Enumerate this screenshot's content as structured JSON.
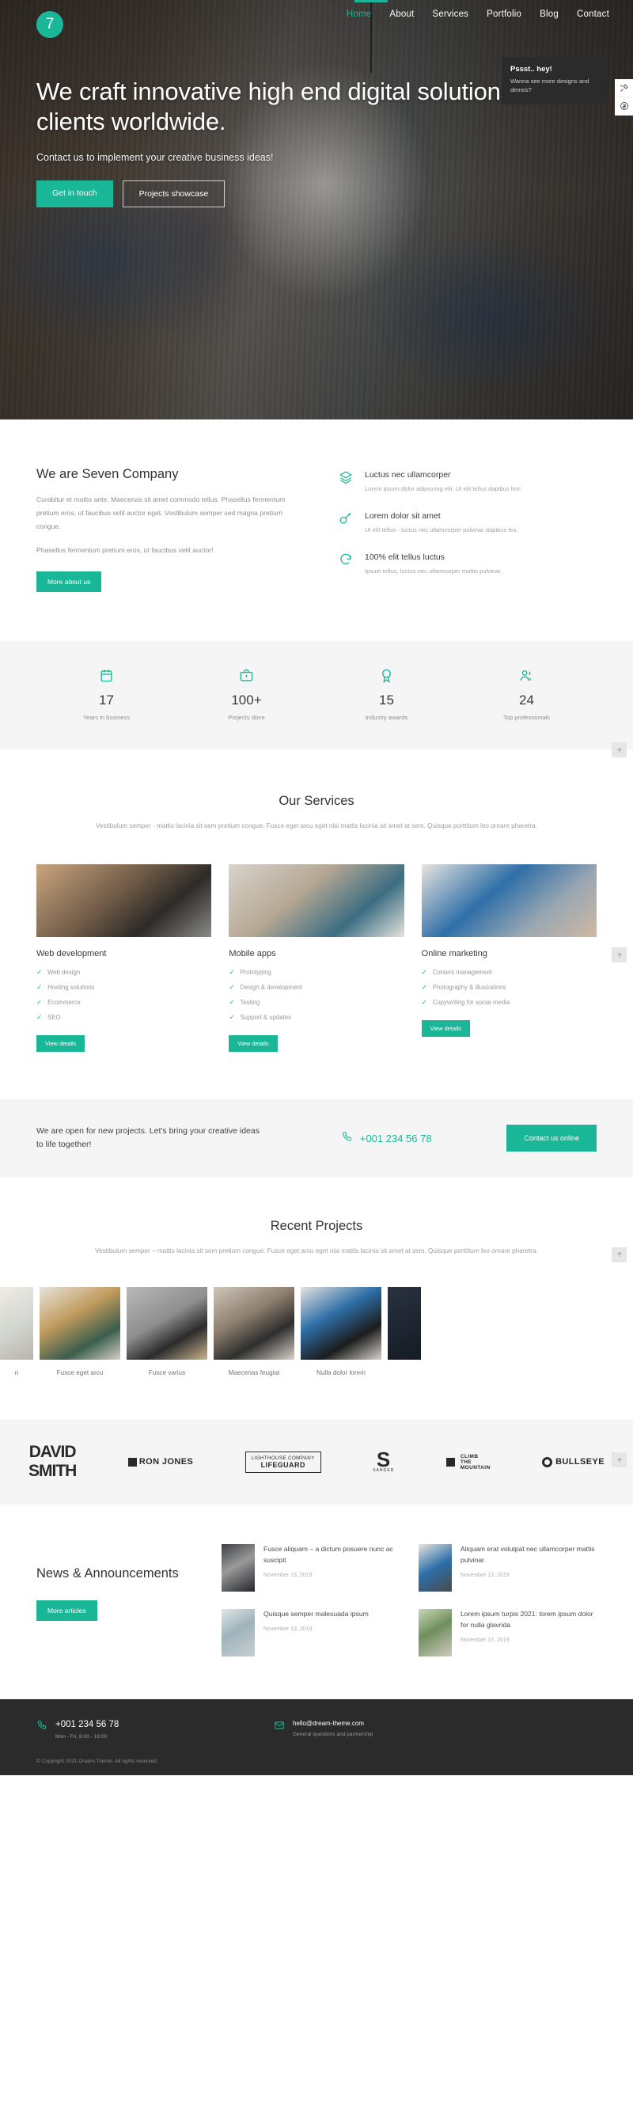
{
  "brand": {
    "logo_text": "7",
    "accent": "#19b698",
    "dark": "#2b2b2b"
  },
  "nav": {
    "items": [
      {
        "label": "Home",
        "active": true
      },
      {
        "label": "About",
        "active": false
      },
      {
        "label": "Services",
        "active": false
      },
      {
        "label": "Portfolio",
        "active": false
      },
      {
        "label": "Blog",
        "active": false
      },
      {
        "label": "Contact",
        "active": false
      }
    ]
  },
  "promo": {
    "title": "Pssst.. hey!",
    "text": "Wanna see more designs and demos?"
  },
  "hero": {
    "heading": "We craft innovative high end digital solutions for clients worldwide.",
    "subheading": "Contact us to implement your creative business ideas!",
    "primary_button": "Get in touch",
    "secondary_button": "Projects showcase"
  },
  "about": {
    "title": "We are Seven Company",
    "paragraph1": "Curabitur et mattis ante. Maecenas sit amet commodo tellus. Phasellus fermentum pretium eros, ut faucibus velit auctor eget. Vestibulum semper sed magna pretium congue.",
    "paragraph2": "Phasellus fermentum pretium eros, ut faucibus velit auctor!",
    "button": "More about us",
    "features": [
      {
        "icon": "layers-icon",
        "title": "Luctus nec ullamcorper",
        "text": "Lorem ipsum dolor adipiscing elit. Ut elit tellus dapibus leo!"
      },
      {
        "icon": "key-icon",
        "title": "Lorem dolor sit amet",
        "text": "Ut elit tellus - luctus nec ullamcorper pulvinar dapibus leo."
      },
      {
        "icon": "refresh-icon",
        "title": "100% elit tellus luctus",
        "text": "Ipsum tellus, luctus nec ullamcorper mattis pulvinar."
      }
    ]
  },
  "stats": [
    {
      "icon": "calendar-icon",
      "number": "17",
      "label": "Years in business"
    },
    {
      "icon": "briefcase-icon",
      "number": "100+",
      "label": "Projects done"
    },
    {
      "icon": "award-icon",
      "number": "15",
      "label": "Industry awards"
    },
    {
      "icon": "people-icon",
      "number": "24",
      "label": "Top professionals"
    }
  ],
  "services": {
    "title": "Our Services",
    "subtitle": "Vestibulum semper - mattis lacinia sit sem pretium congue. Fusce eget arcu eget nisi mattis lacinia sit amet at sem. Quisque porttitum leo ornare pharetra.",
    "cards": [
      {
        "title": "Web development",
        "items": [
          "Web design",
          "Hosting solutions",
          "Ecommerce",
          "SEO"
        ],
        "button": "View details"
      },
      {
        "title": "Mobile apps",
        "items": [
          "Prototyping",
          "Design & development",
          "Testing",
          "Support & updates"
        ],
        "button": "View details"
      },
      {
        "title": "Online marketing",
        "items": [
          "Content management",
          "Photography & illustrations",
          "Copywriting for social media"
        ],
        "button": "View details"
      }
    ]
  },
  "cta": {
    "text": "We are open for new projects. Let's bring your creative ideas to life together!",
    "phone": "+001 234 56 78",
    "button": "Contact us online"
  },
  "projects": {
    "title": "Recent Projects",
    "subtitle": "Vestibulum semper – mattis lacinia sit sem pretium congue. Fusce eget arcu eget nisi mattis lacinia sit amet at sem. Quisque porttitum leo ornare pharetra.",
    "items": [
      {
        "caption": "n"
      },
      {
        "caption": "Fusce eget arcu"
      },
      {
        "caption": "Fusce varius"
      },
      {
        "caption": "Maecenas feugiat"
      },
      {
        "caption": "Nulla dolor lorem"
      },
      {
        "caption": ""
      }
    ]
  },
  "clients": [
    {
      "kind": "david",
      "line1": "DAVID",
      "line2": "SMITH"
    },
    {
      "kind": "ronjones",
      "line1": "RJ",
      "line2": "RON JONES"
    },
    {
      "kind": "lifeguard",
      "line1": "LIGHTHOUSE COMPANY",
      "line2": "LIFEGUARD"
    },
    {
      "kind": "sanger",
      "line1": "S",
      "line2": "SANGER"
    },
    {
      "kind": "climb",
      "line1": "CLIMB",
      "line2": "THE",
      "line3": "MOUNTAIN"
    },
    {
      "kind": "bullseye",
      "line1": "BULLSEYE"
    }
  ],
  "news": {
    "title": "News & Announcements",
    "button": "More articles",
    "posts": [
      {
        "title": "Fusce aliquam – a dictum posuere nunc ac suscipit",
        "date": "November 13, 2019"
      },
      {
        "title": "Aliquam erat volutpat nec ullamcorper mattis pulvinar",
        "date": "November 13, 2019"
      },
      {
        "title": "Quisque semper malesuada ipsum",
        "date": "November 13, 2019"
      },
      {
        "title": "Lorem ipsum turpis 2021: lorem ipsum dolor for nulla glavrida",
        "date": "November 13, 2019"
      }
    ]
  },
  "footer": {
    "phone": "+001 234 56 78",
    "phone_note": "Mon - Fri, 8:00 - 19:00",
    "email": "hello@dream-theme.com",
    "email_note": "General questions and partnership",
    "copyright": "© Copyright 2021 Dream-Theme. All rights reserved."
  },
  "scroll_top_icon": "arrow-up-icon"
}
